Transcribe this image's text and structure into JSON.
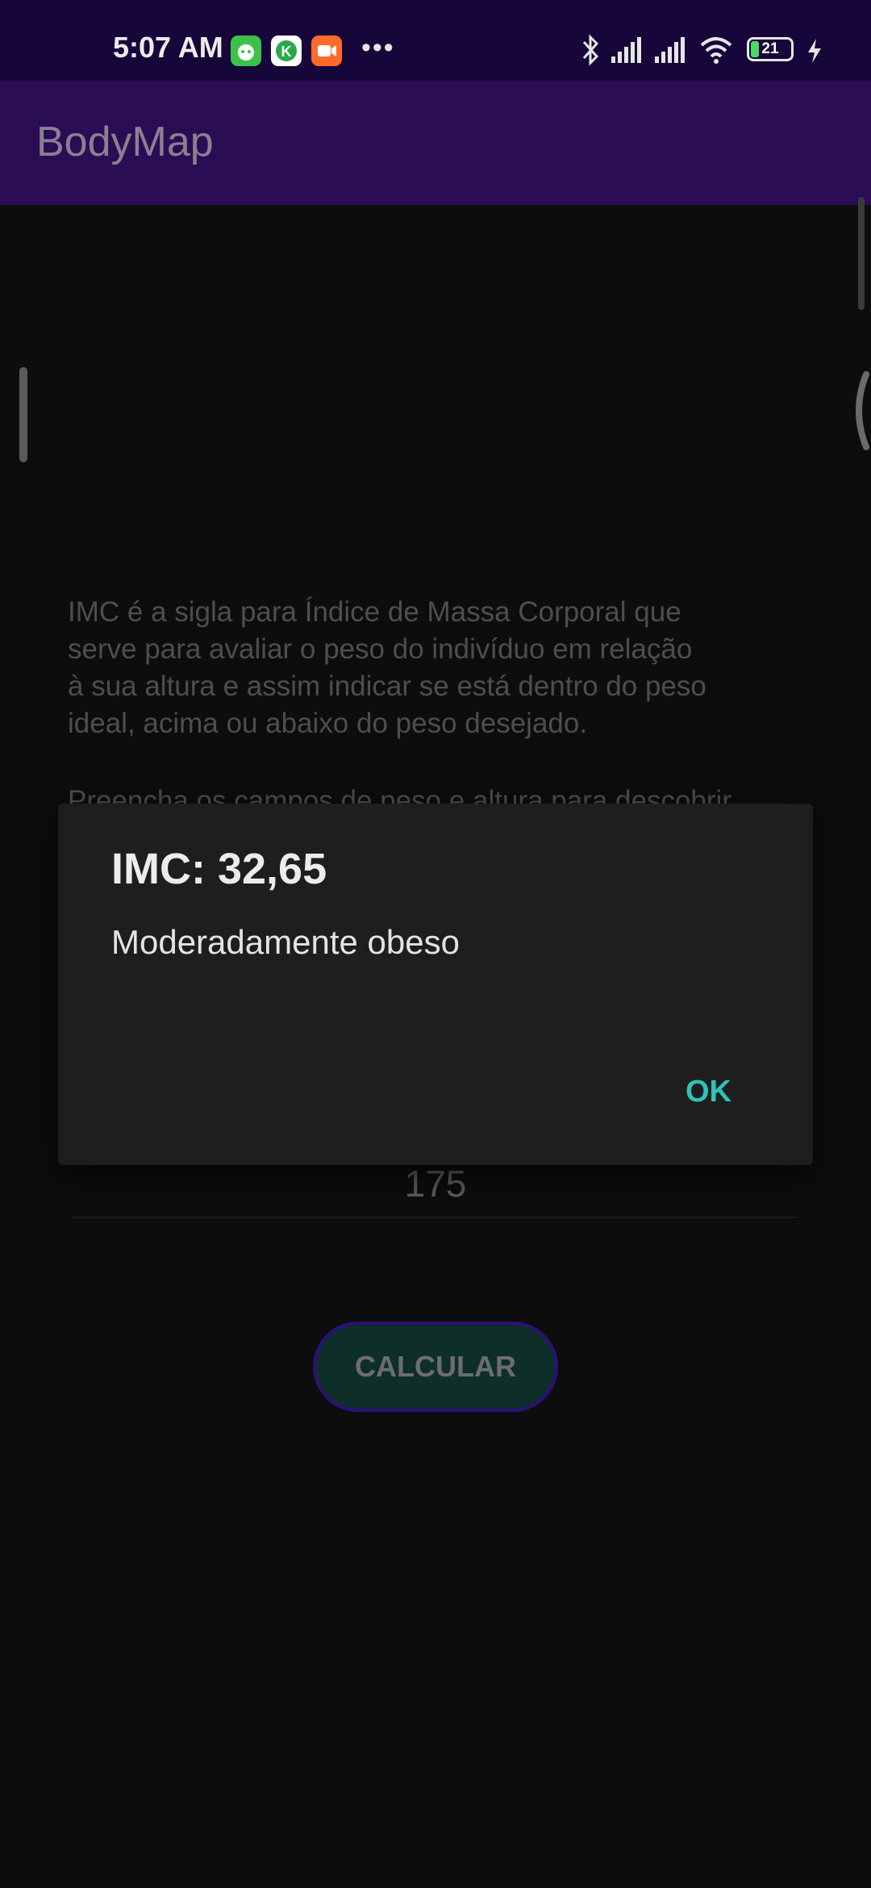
{
  "status_bar": {
    "time": "5:07 AM",
    "notification_icons": [
      "android-robot-icon",
      "k-app-icon",
      "video-camera-icon"
    ],
    "more": "•••",
    "battery_level": "21",
    "colors": {
      "background": "#16063a"
    }
  },
  "app_bar": {
    "title": "BodyMap",
    "color": "#2a0d55"
  },
  "content": {
    "info_paragraph": "IMC é a sigla para Índice de Massa Corporal que\nserve para avaliar o peso do indivíduo em relação\nà sua altura e assim indicar se está dentro do peso\nideal, acima ou abaixo do peso desejado.",
    "info_paragraph_2": "Preencha os campos de peso e altura para descobrir",
    "height_value": "175",
    "calculate_label": "CALCULAR"
  },
  "dialog": {
    "title": "IMC: 32,65",
    "message": "Moderadamente obeso",
    "ok_label": "OK",
    "accent_color": "#2ec4b6"
  }
}
